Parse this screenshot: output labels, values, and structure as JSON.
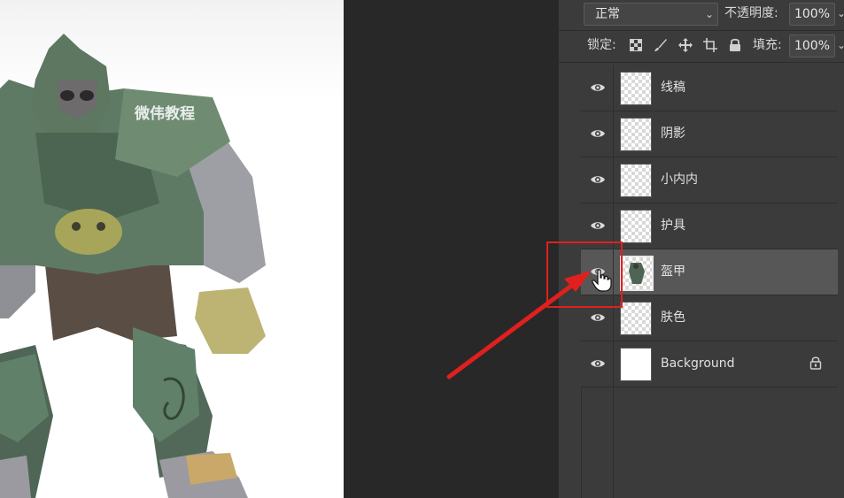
{
  "watermark": "微伟教程",
  "layers_panel": {
    "blend_mode": "正常",
    "opacity_label": "不透明度:",
    "opacity_value": "100%",
    "lock_label": "锁定:",
    "fill_label": "填充:",
    "fill_value": "100%",
    "layers": [
      {
        "name": "线稿",
        "visible": true,
        "selected": false
      },
      {
        "name": "阴影",
        "visible": true,
        "selected": false
      },
      {
        "name": "小内内",
        "visible": true,
        "selected": false
      },
      {
        "name": "护具",
        "visible": true,
        "selected": false
      },
      {
        "name": "盔甲",
        "visible": true,
        "selected": true
      },
      {
        "name": "肤色",
        "visible": true,
        "selected": false
      },
      {
        "name": "Background",
        "visible": true,
        "selected": false,
        "locked": true
      }
    ]
  },
  "colors": {
    "annotation_red": "#e0201e",
    "panel_bg": "#3b3b3b",
    "selected_row": "#575757"
  }
}
